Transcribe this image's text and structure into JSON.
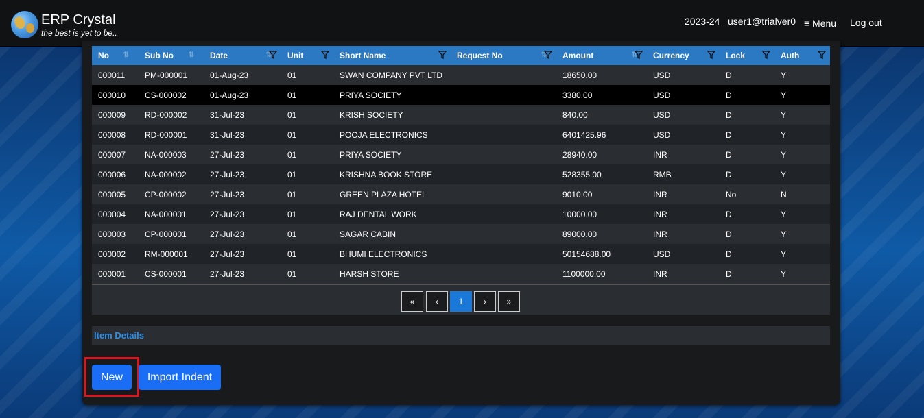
{
  "brand": {
    "title": "ERP Crystal",
    "tagline": "the best is yet to be.."
  },
  "header": {
    "fiscal_year": "2023-24",
    "user": "user1@trialver0",
    "menu_label": "≡ Menu",
    "logout_label": "Log out"
  },
  "table": {
    "columns": [
      "No",
      "Sub No",
      "Date",
      "Unit",
      "Short Name",
      "Request No",
      "Amount",
      "Currency",
      "Lock",
      "Auth"
    ],
    "rows": [
      [
        "000011",
        "PM-000001",
        "01-Aug-23",
        "01",
        "SWAN COMPANY PVT LTD",
        "",
        "18650.00",
        "USD",
        "D",
        "Y"
      ],
      [
        "000010",
        "CS-000002",
        "01-Aug-23",
        "01",
        "PRIYA SOCIETY",
        "",
        "3380.00",
        "USD",
        "D",
        "Y"
      ],
      [
        "000009",
        "RD-000002",
        "31-Jul-23",
        "01",
        "KRISH SOCIETY",
        "",
        "840.00",
        "USD",
        "D",
        "Y"
      ],
      [
        "000008",
        "RD-000001",
        "31-Jul-23",
        "01",
        "POOJA ELECTRONICS",
        "",
        "6401425.96",
        "USD",
        "D",
        "Y"
      ],
      [
        "000007",
        "NA-000003",
        "27-Jul-23",
        "01",
        "PRIYA SOCIETY",
        "",
        "28940.00",
        "INR",
        "D",
        "Y"
      ],
      [
        "000006",
        "NA-000002",
        "27-Jul-23",
        "01",
        "KRISHNA BOOK STORE",
        "",
        "528355.00",
        "RMB",
        "D",
        "Y"
      ],
      [
        "000005",
        "CP-000002",
        "27-Jul-23",
        "01",
        "GREEN PLAZA HOTEL",
        "",
        "9010.00",
        "INR",
        "No",
        "N"
      ],
      [
        "000004",
        "NA-000001",
        "27-Jul-23",
        "01",
        "RAJ DENTAL WORK",
        "",
        "10000.00",
        "INR",
        "D",
        "Y"
      ],
      [
        "000003",
        "CP-000001",
        "27-Jul-23",
        "01",
        "SAGAR CABIN",
        "",
        "89000.00",
        "INR",
        "D",
        "Y"
      ],
      [
        "000002",
        "RM-000001",
        "27-Jul-23",
        "01",
        "BHUMI ELECTRONICS",
        "",
        "50154688.00",
        "USD",
        "D",
        "Y"
      ],
      [
        "000001",
        "CS-000001",
        "27-Jul-23",
        "01",
        "HARSH STORE",
        "",
        "1100000.00",
        "INR",
        "D",
        "Y"
      ]
    ],
    "selected_row_index": 1
  },
  "pagination": {
    "first": "«",
    "prev": "‹",
    "current": "1",
    "next": "›",
    "last": "»"
  },
  "item_details_label": "Item Details",
  "buttons": {
    "new_label": "New",
    "import_label": "Import Indent"
  },
  "colors": {
    "header_blue": "#2b79c2",
    "primary_button": "#1a6ef5",
    "highlight_red": "#e0141d"
  }
}
